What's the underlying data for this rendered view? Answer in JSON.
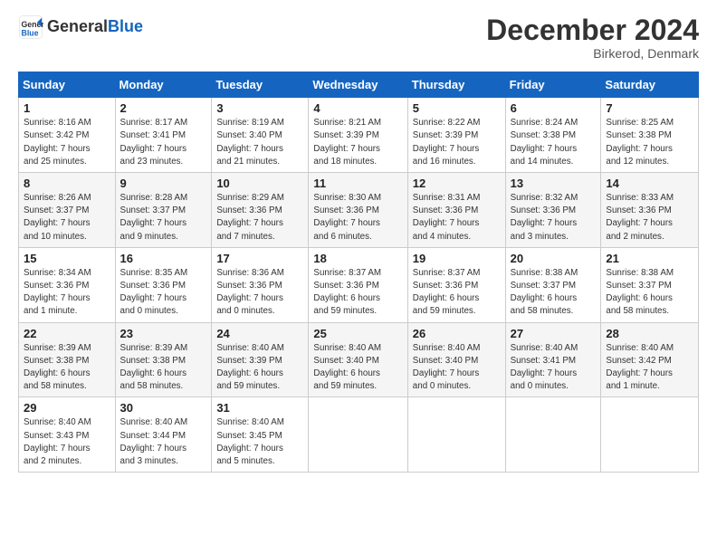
{
  "header": {
    "logo_line1": "General",
    "logo_line2": "Blue",
    "month": "December 2024",
    "location": "Birkerod, Denmark"
  },
  "weekdays": [
    "Sunday",
    "Monday",
    "Tuesday",
    "Wednesday",
    "Thursday",
    "Friday",
    "Saturday"
  ],
  "weeks": [
    [
      {
        "day": "1",
        "info": "Sunrise: 8:16 AM\nSunset: 3:42 PM\nDaylight: 7 hours\nand 25 minutes."
      },
      {
        "day": "2",
        "info": "Sunrise: 8:17 AM\nSunset: 3:41 PM\nDaylight: 7 hours\nand 23 minutes."
      },
      {
        "day": "3",
        "info": "Sunrise: 8:19 AM\nSunset: 3:40 PM\nDaylight: 7 hours\nand 21 minutes."
      },
      {
        "day": "4",
        "info": "Sunrise: 8:21 AM\nSunset: 3:39 PM\nDaylight: 7 hours\nand 18 minutes."
      },
      {
        "day": "5",
        "info": "Sunrise: 8:22 AM\nSunset: 3:39 PM\nDaylight: 7 hours\nand 16 minutes."
      },
      {
        "day": "6",
        "info": "Sunrise: 8:24 AM\nSunset: 3:38 PM\nDaylight: 7 hours\nand 14 minutes."
      },
      {
        "day": "7",
        "info": "Sunrise: 8:25 AM\nSunset: 3:38 PM\nDaylight: 7 hours\nand 12 minutes."
      }
    ],
    [
      {
        "day": "8",
        "info": "Sunrise: 8:26 AM\nSunset: 3:37 PM\nDaylight: 7 hours\nand 10 minutes."
      },
      {
        "day": "9",
        "info": "Sunrise: 8:28 AM\nSunset: 3:37 PM\nDaylight: 7 hours\nand 9 minutes."
      },
      {
        "day": "10",
        "info": "Sunrise: 8:29 AM\nSunset: 3:36 PM\nDaylight: 7 hours\nand 7 minutes."
      },
      {
        "day": "11",
        "info": "Sunrise: 8:30 AM\nSunset: 3:36 PM\nDaylight: 7 hours\nand 6 minutes."
      },
      {
        "day": "12",
        "info": "Sunrise: 8:31 AM\nSunset: 3:36 PM\nDaylight: 7 hours\nand 4 minutes."
      },
      {
        "day": "13",
        "info": "Sunrise: 8:32 AM\nSunset: 3:36 PM\nDaylight: 7 hours\nand 3 minutes."
      },
      {
        "day": "14",
        "info": "Sunrise: 8:33 AM\nSunset: 3:36 PM\nDaylight: 7 hours\nand 2 minutes."
      }
    ],
    [
      {
        "day": "15",
        "info": "Sunrise: 8:34 AM\nSunset: 3:36 PM\nDaylight: 7 hours\nand 1 minute."
      },
      {
        "day": "16",
        "info": "Sunrise: 8:35 AM\nSunset: 3:36 PM\nDaylight: 7 hours\nand 0 minutes."
      },
      {
        "day": "17",
        "info": "Sunrise: 8:36 AM\nSunset: 3:36 PM\nDaylight: 7 hours\nand 0 minutes."
      },
      {
        "day": "18",
        "info": "Sunrise: 8:37 AM\nSunset: 3:36 PM\nDaylight: 6 hours\nand 59 minutes."
      },
      {
        "day": "19",
        "info": "Sunrise: 8:37 AM\nSunset: 3:36 PM\nDaylight: 6 hours\nand 59 minutes."
      },
      {
        "day": "20",
        "info": "Sunrise: 8:38 AM\nSunset: 3:37 PM\nDaylight: 6 hours\nand 58 minutes."
      },
      {
        "day": "21",
        "info": "Sunrise: 8:38 AM\nSunset: 3:37 PM\nDaylight: 6 hours\nand 58 minutes."
      }
    ],
    [
      {
        "day": "22",
        "info": "Sunrise: 8:39 AM\nSunset: 3:38 PM\nDaylight: 6 hours\nand 58 minutes."
      },
      {
        "day": "23",
        "info": "Sunrise: 8:39 AM\nSunset: 3:38 PM\nDaylight: 6 hours\nand 58 minutes."
      },
      {
        "day": "24",
        "info": "Sunrise: 8:40 AM\nSunset: 3:39 PM\nDaylight: 6 hours\nand 59 minutes."
      },
      {
        "day": "25",
        "info": "Sunrise: 8:40 AM\nSunset: 3:40 PM\nDaylight: 6 hours\nand 59 minutes."
      },
      {
        "day": "26",
        "info": "Sunrise: 8:40 AM\nSunset: 3:40 PM\nDaylight: 7 hours\nand 0 minutes."
      },
      {
        "day": "27",
        "info": "Sunrise: 8:40 AM\nSunset: 3:41 PM\nDaylight: 7 hours\nand 0 minutes."
      },
      {
        "day": "28",
        "info": "Sunrise: 8:40 AM\nSunset: 3:42 PM\nDaylight: 7 hours\nand 1 minute."
      }
    ],
    [
      {
        "day": "29",
        "info": "Sunrise: 8:40 AM\nSunset: 3:43 PM\nDaylight: 7 hours\nand 2 minutes."
      },
      {
        "day": "30",
        "info": "Sunrise: 8:40 AM\nSunset: 3:44 PM\nDaylight: 7 hours\nand 3 minutes."
      },
      {
        "day": "31",
        "info": "Sunrise: 8:40 AM\nSunset: 3:45 PM\nDaylight: 7 hours\nand 5 minutes."
      },
      {
        "day": "",
        "info": ""
      },
      {
        "day": "",
        "info": ""
      },
      {
        "day": "",
        "info": ""
      },
      {
        "day": "",
        "info": ""
      }
    ]
  ]
}
